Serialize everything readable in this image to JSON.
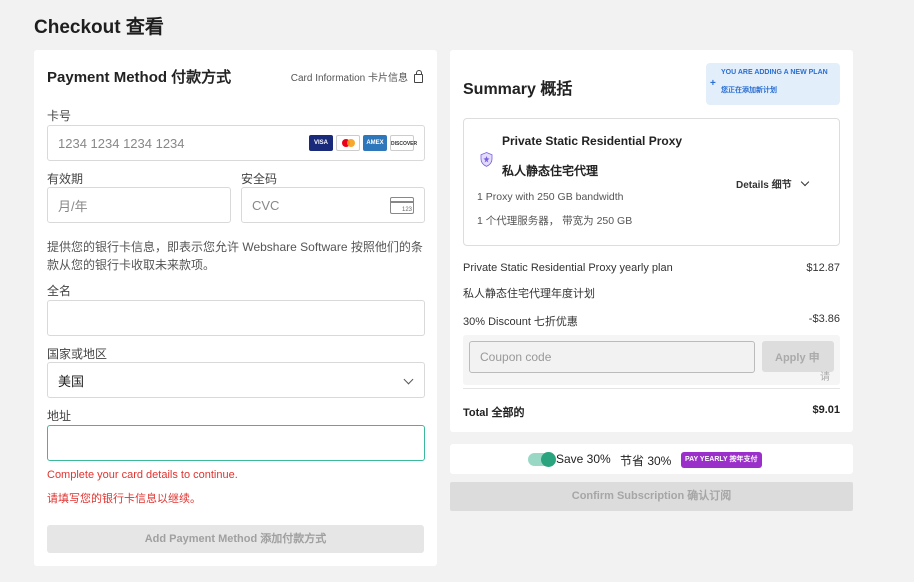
{
  "page": {
    "title": "Checkout  查看"
  },
  "payment": {
    "title": "Payment Method  付款方式",
    "card_info": "Card Information  卡片信息",
    "card_number": {
      "label": "卡号",
      "placeholder": "1234 1234 1234 1234"
    },
    "brands": [
      "VISA",
      "",
      "AMEX",
      "DISCOVER"
    ],
    "expiry": {
      "label": "有效期",
      "placeholder": "月/年"
    },
    "cvc": {
      "label": "安全码",
      "placeholder": "CVC",
      "icon_text": "123"
    },
    "disclaimer": "提供您的银行卡信息，即表示您允许 Webshare Software 按照他们的条款从您的银行卡收取未来款项。",
    "full_name": {
      "label": "全名",
      "value": ""
    },
    "country": {
      "label": "国家或地区",
      "value": "美国"
    },
    "address": {
      "label": "地址",
      "value": ""
    },
    "error_en": "Complete your card details to continue.",
    "error_cn": "请填写您的银行卡信息以继续。",
    "add_button": "Add Payment Method  添加付款方式"
  },
  "summary": {
    "title": "Summary  概括",
    "new_plan_l1": "YOU ARE ADDING A NEW PLAN",
    "new_plan_l2": "您正在添加新计划",
    "product": {
      "name": "Private Static Residential Proxy",
      "name_cn": "私人静态住宅代理",
      "detail1": "1 Proxy with 250 GB bandwidth",
      "detail2": "1 个代理服务器， 带宽为 250 GB",
      "details_label": "Details   细节"
    },
    "plan_line": "Private Static Residential Proxy yearly plan",
    "plan_line_cn": "私人静态住宅代理年度计划",
    "plan_amount": "$12.87",
    "discount_line": "30% Discount  七折优惠",
    "discount_amount": "-$3.86",
    "coupon_placeholder": "Coupon code",
    "apply_button": "Apply 申",
    "apply_overflow": "请",
    "total_label": "Total  全部的",
    "total_amount": "$9.01"
  },
  "save": {
    "text": "Save 30%",
    "text_cn": "节省 30%",
    "badge": "PAY YEARLY  按年支付",
    "toggle_on": true
  },
  "confirm_button": "Confirm Subscription  确认订阅",
  "colors": {
    "accent": "#2aa37f",
    "error": "#e0332f",
    "badge": "#9b2fc9",
    "info": "#2a6fd1"
  }
}
